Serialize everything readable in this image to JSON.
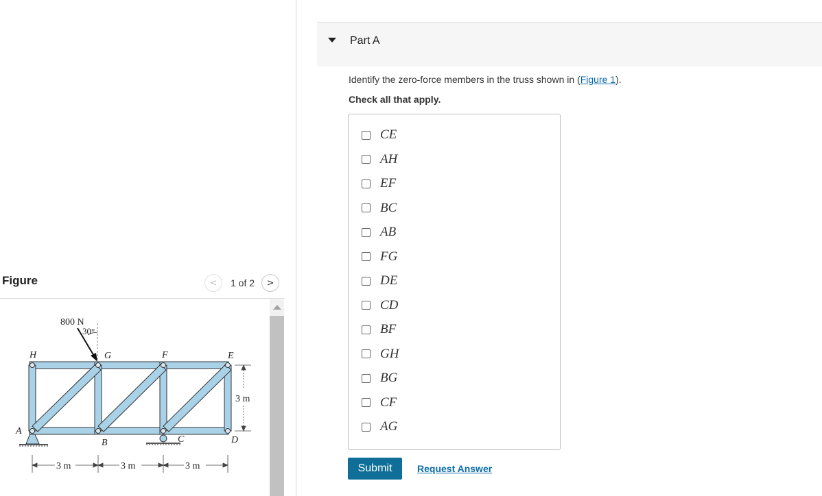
{
  "figure_panel": {
    "heading": "Figure",
    "pager": {
      "prev_icon": "chevron-left-icon",
      "next_icon": "chevron-right-icon",
      "prev_glyph": "<",
      "next_glyph": ">",
      "current": "1 of 2"
    },
    "truss": {
      "load": "800 N",
      "angle": "30°",
      "joints": {
        "A": "A",
        "B": "B",
        "C": "C",
        "D": "D",
        "E": "E",
        "F": "F",
        "G": "G",
        "H": "H"
      },
      "span_labels": [
        "3 m",
        "3 m",
        "3 m"
      ],
      "height_label": "3 m",
      "member_color": "#a9d2e8"
    }
  },
  "part": {
    "toggle_icon": "caret-down-icon",
    "title": "Part A",
    "question_prefix": "Identify the zero-force members in the truss shown in (",
    "figure_link": "Figure 1",
    "question_suffix": ").",
    "instruction": "Check all that apply.",
    "options": [
      "CE",
      "AH",
      "EF",
      "BC",
      "AB",
      "FG",
      "DE",
      "CD",
      "BF",
      "GH",
      "BG",
      "CF",
      "AG"
    ],
    "submit_label": "Submit",
    "request_answer_label": "Request Answer",
    "accent_color": "#0f6f98",
    "link_color": "#0a6ba8"
  }
}
